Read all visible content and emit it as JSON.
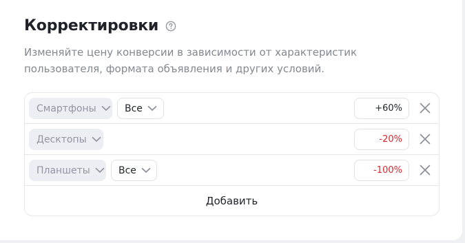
{
  "header": {
    "title": "Корректировки",
    "help_icon": "question-circle-icon"
  },
  "description": "Изменяйте цену конверсии в зависимости от характеристик пользователя, формата объявления и других условий.",
  "adjustments": [
    {
      "device": "Смартфоны",
      "os": "Все",
      "value": "+60",
      "unit": "%"
    },
    {
      "device": "Десктопы",
      "value": "-20",
      "unit": "%"
    },
    {
      "device": "Планшеты",
      "os": "Все",
      "value": "-100",
      "unit": "%"
    }
  ],
  "add_label": "Добавить",
  "colors": {
    "text": "#1f2329",
    "muted": "#838891",
    "negative": "#e0242b",
    "chip_bg": "#ebeef3",
    "border": "#e4e6ea"
  }
}
